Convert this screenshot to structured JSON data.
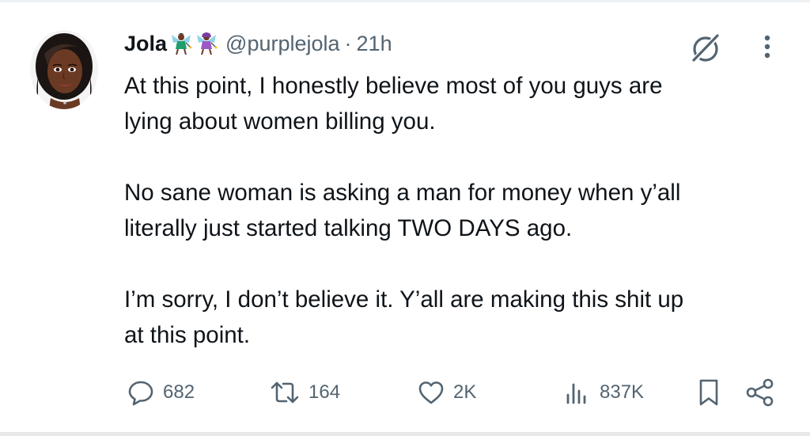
{
  "tweet": {
    "display_name": "Jola",
    "handle": "@purplejola",
    "separator": "·",
    "timestamp": "21h",
    "paragraphs": [
      "At this point, I honestly believe most of you guys are\nlying about women billing you.",
      "No sane woman is asking a man for money when y’all\nliterally just started talking TWO DAYS ago.",
      "I’m sorry, I don’t believe it. Y’all are making this shit up\nat this point."
    ]
  },
  "icons": {
    "avatar": "avatar-portrait",
    "name_emojis": [
      "fairy-emoji",
      "fairy-emoji"
    ],
    "grok": "grok-icon",
    "more": "more-vertical-icon",
    "reply": "reply-icon",
    "retweet": "retweet-icon",
    "like": "heart-icon",
    "views": "views-chart-icon",
    "bookmark": "bookmark-icon",
    "share": "share-icon"
  },
  "actions": {
    "replies": "682",
    "retweets": "164",
    "likes": "2K",
    "views": "837K"
  },
  "colors": {
    "text": "#0f1419",
    "secondary": "#536471",
    "background": "#ffffff"
  }
}
